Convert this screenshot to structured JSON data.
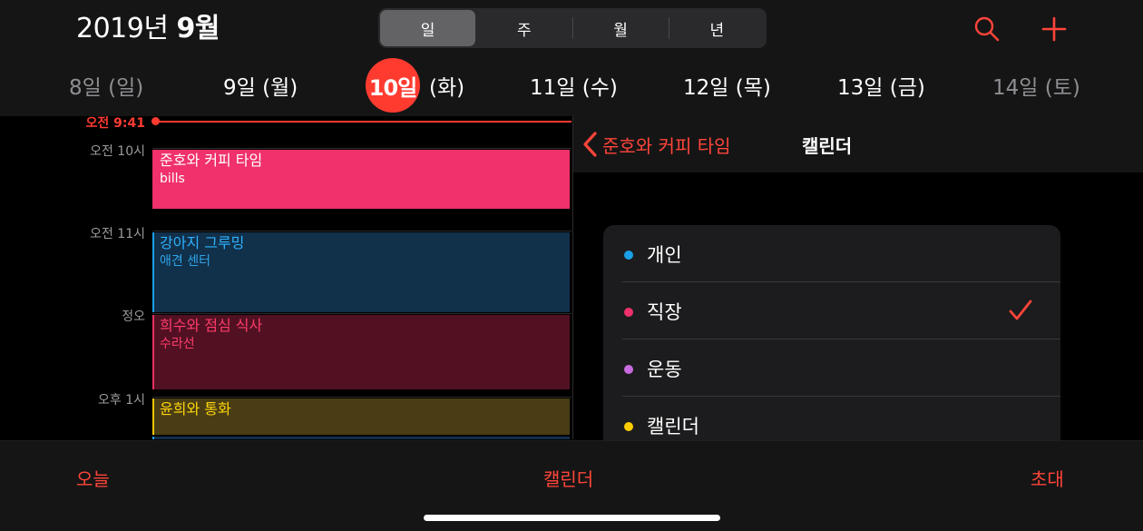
{
  "header": {
    "title_year": "2019년",
    "title_month": "9월",
    "view_segments": [
      {
        "label": "일",
        "active": true
      },
      {
        "label": "주",
        "active": false
      },
      {
        "label": "월",
        "active": false
      },
      {
        "label": "년",
        "active": false
      }
    ],
    "search_icon": "search-icon",
    "add_icon": "plus-icon",
    "accent_color": "#ff3b30"
  },
  "days": [
    {
      "date": "8일",
      "weekday": "(일)",
      "dim": true
    },
    {
      "date": "9일",
      "weekday": "(월)",
      "dim": false
    },
    {
      "date": "10일",
      "weekday": "(화)",
      "today": true
    },
    {
      "date": "11일",
      "weekday": "(수)",
      "dim": false
    },
    {
      "date": "12일",
      "weekday": "(목)",
      "dim": false
    },
    {
      "date": "13일",
      "weekday": "(금)",
      "dim": false
    },
    {
      "date": "14일",
      "weekday": "(토)",
      "dim": true
    }
  ],
  "timeline": {
    "now_label": "오전 9:41",
    "hours": [
      "오전 10시",
      "오전 11시",
      "정오",
      "오후 1시"
    ],
    "events": [
      {
        "title": "준호와 커피 타임",
        "subtitle": "bills",
        "bg": "#f0316b",
        "bar": "#f0316b",
        "title_color": "#ffffff",
        "sub_color": "#ffffff"
      },
      {
        "title": "강아지 그루밍",
        "subtitle": "애견 센터",
        "bg": "#11304a",
        "bar": "#1aa0e8",
        "title_color": "#2fb0ff",
        "sub_color": "#2fa3e8"
      },
      {
        "title": "희수와 점심 식사",
        "subtitle": "수라선",
        "bg": "#521122",
        "bar": "#e83161",
        "title_color": "#ff3b6b",
        "sub_color": "#ff3b6b"
      },
      {
        "title": "윤희와 통화",
        "subtitle": "",
        "bg": "#4a3d14",
        "bar": "#f7c600",
        "title_color": "#ffd60a",
        "sub_color": "#ffd60a"
      }
    ]
  },
  "panel": {
    "back_label": "준호와 커피 타임",
    "back_icon": "chevron-left-icon",
    "title": "캘린더",
    "calendars": [
      {
        "name": "개인",
        "color": "#1aa0e8",
        "checked": false
      },
      {
        "name": "직장",
        "color": "#f0316b",
        "checked": true
      },
      {
        "name": "운동",
        "color": "#c86be0",
        "checked": false
      },
      {
        "name": "캘린더",
        "color": "#ffcc00",
        "checked": false
      }
    ],
    "check_icon": "checkmark-icon"
  },
  "toolbar": {
    "today_label": "오늘",
    "calendars_label": "캘린더",
    "inbox_label": "초대"
  }
}
